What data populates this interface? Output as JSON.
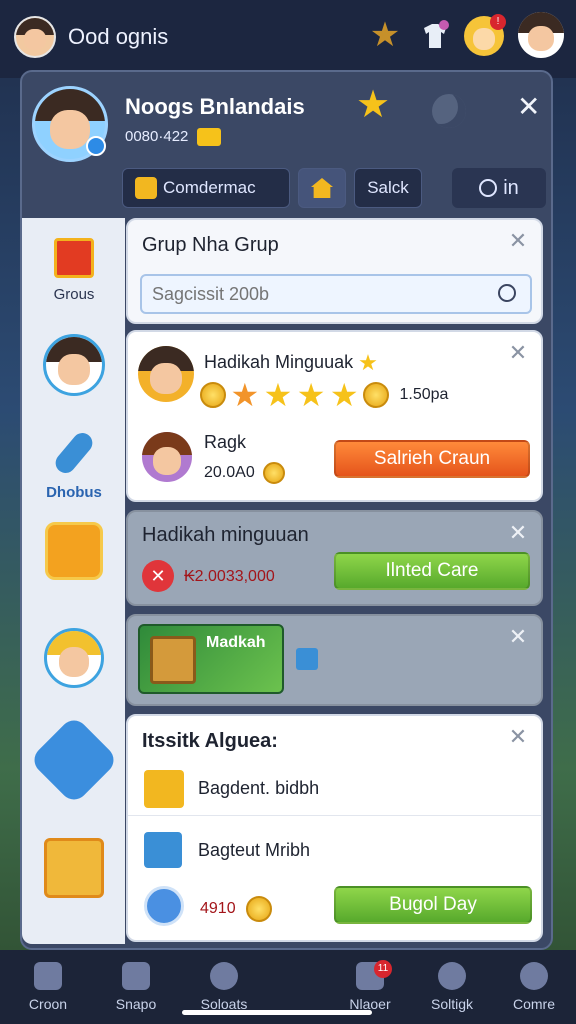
{
  "topbar": {
    "title": "Ood ognis"
  },
  "profile": {
    "name": "Noogs Bnlandais",
    "code": "0080·422"
  },
  "tabs": [
    {
      "label": "Comdermac"
    },
    {
      "label": "Salck"
    },
    {
      "label": "in"
    }
  ],
  "sidebar": {
    "items": [
      {
        "label": "Grous"
      },
      {
        "label": ""
      },
      {
        "label": "Dhobus"
      },
      {
        "label": ""
      },
      {
        "label": ""
      },
      {
        "label": ""
      },
      {
        "label": ""
      }
    ]
  },
  "group_card": {
    "title": "Grup Nha Grup",
    "search_placeholder": "Sagcissit 200b"
  },
  "reward_card": {
    "title": "Hadikah Minguuak",
    "amount": "1.50pa",
    "stars": 4,
    "row2_label": "Ragk",
    "row2_value": "20.0A0",
    "button": "Salrieh Craun"
  },
  "weekly_card": {
    "title": "Hadikah minguuan",
    "value": "₭2.0033,000",
    "button": "Ilnted Care"
  },
  "banner_card": {
    "title": "Madkah"
  },
  "list_card": {
    "title": "Itssitk Alguea:",
    "items": [
      {
        "label": "Bagdent. bidbh"
      },
      {
        "label": "Bagteut Mribh"
      }
    ],
    "value": "4910",
    "button": "Bugol Day"
  },
  "navbar": {
    "items": [
      {
        "label": "Croon"
      },
      {
        "label": "Snapo"
      },
      {
        "label": "Soloats"
      },
      {
        "label": "Nlaoer"
      },
      {
        "label": "Soltigk"
      },
      {
        "label": "Comre"
      }
    ],
    "badge": "11"
  },
  "colors": {
    "accent_orange": "#e5541b",
    "accent_green": "#57a92c",
    "panel": "#3b4865"
  }
}
